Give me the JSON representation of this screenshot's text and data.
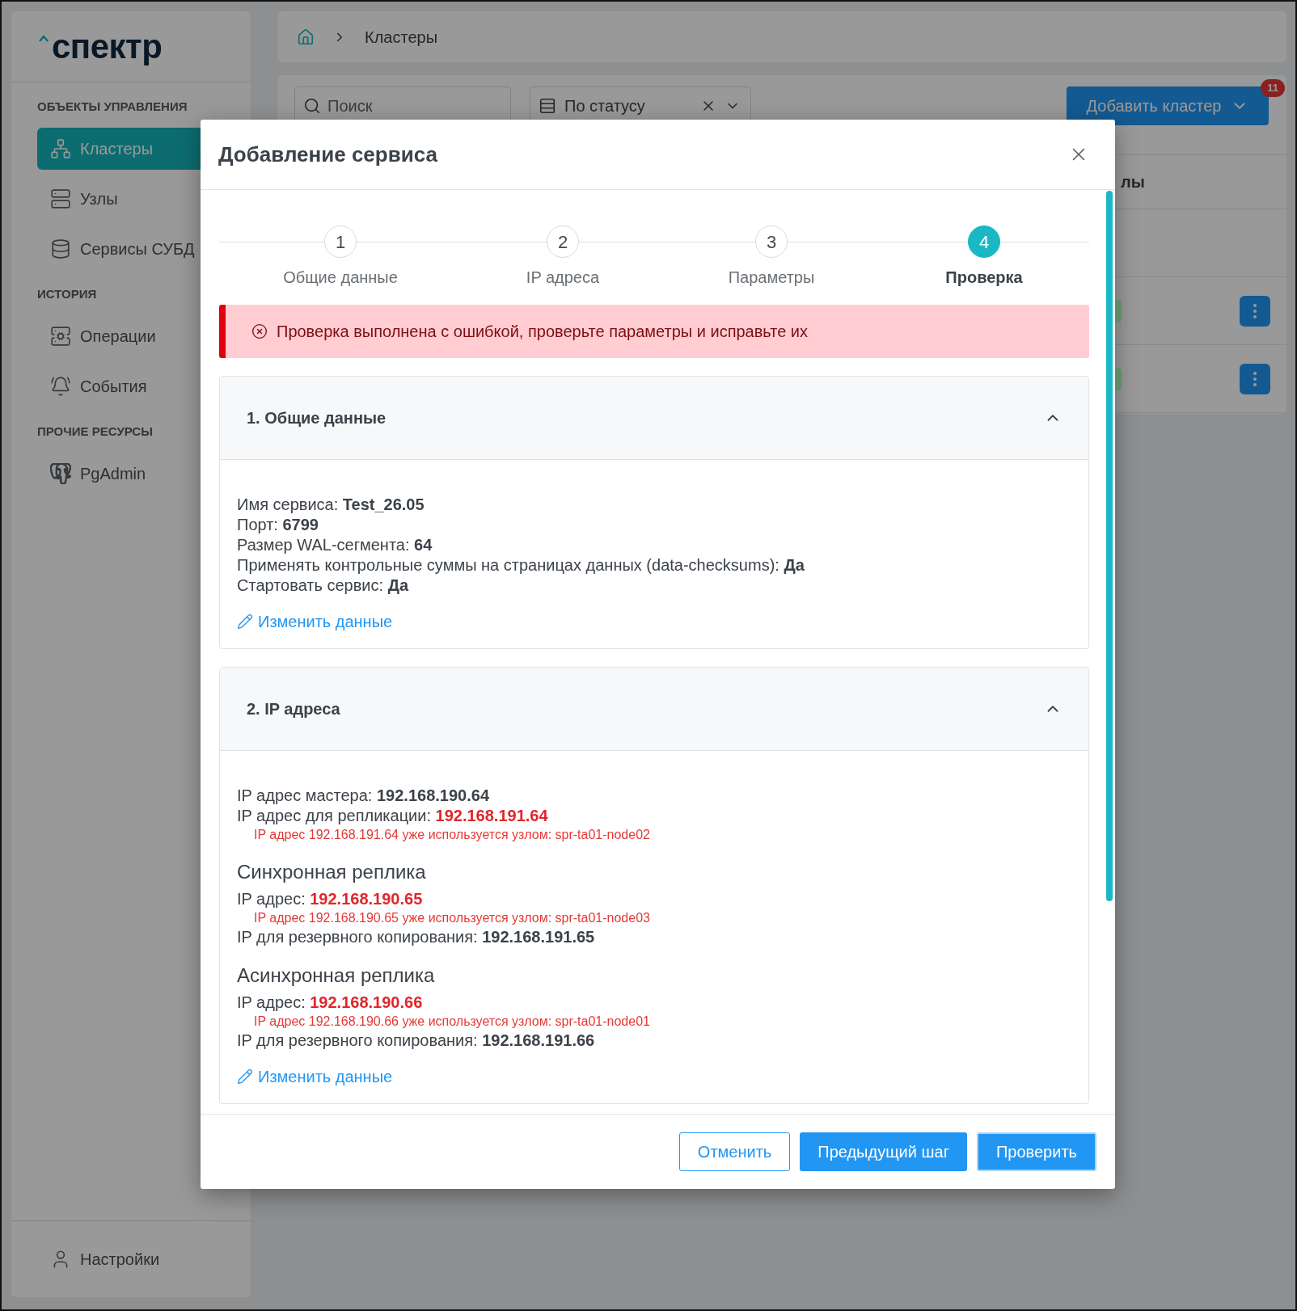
{
  "sidebar": {
    "logo": "спектр",
    "groups": [
      {
        "title": "ОБЪЕКТЫ УПРАВЛЕНИЯ",
        "items": [
          {
            "kind": "clusters",
            "label": "Кластеры",
            "selected": true
          },
          {
            "kind": "nodes",
            "label": "Узлы",
            "selected": false
          },
          {
            "kind": "services",
            "label": "Сервисы СУБД",
            "selected": false
          }
        ]
      },
      {
        "title": "ИСТОРИЯ",
        "items": [
          {
            "kind": "operations",
            "label": "Операции",
            "selected": false
          },
          {
            "kind": "events",
            "label": "События",
            "selected": false
          }
        ]
      },
      {
        "title": "ПРОЧИЕ РЕСУРСЫ",
        "items": [
          {
            "kind": "pgadmin",
            "label": "PgAdmin",
            "selected": false
          }
        ]
      }
    ],
    "footer_item": {
      "kind": "settings",
      "label": "Настройки"
    }
  },
  "breadcrumbs": [
    "Кластеры"
  ],
  "toolbar": {
    "search": {
      "placeholder": "Поиск"
    },
    "status_filter": {
      "placeholder": "По статусу"
    },
    "add_button": {
      "label": "Добавить кластер",
      "badge": "11"
    }
  },
  "table": {
    "columns": [
      "лы"
    ],
    "rows": [
      {
        "menu": false
      },
      {
        "menu": true,
        "color": "#5f8a65"
      },
      {
        "menu": true,
        "color": "#5f8a65"
      }
    ]
  },
  "dialog": {
    "title": "Добавление сервиса",
    "steps": [
      {
        "number": "1",
        "label": "Общие данные",
        "selected": false
      },
      {
        "number": "2",
        "label": "IP адреса",
        "selected": false
      },
      {
        "number": "3",
        "label": "Параметры",
        "selected": false
      },
      {
        "number": "4",
        "label": "Проверка",
        "selected": true
      }
    ],
    "alert": {
      "kind": "error",
      "text": "Проверка выполнена с ошибкой, проверьте параметры и исправьте их"
    },
    "sections": [
      {
        "title": "1. Общие данные",
        "expanded": true,
        "lines": [
          {
            "kind": "field",
            "label": "Имя сервиса:",
            "value": "Test_26.05",
            "invalid": false
          },
          {
            "kind": "field",
            "label": "Порт:",
            "value": "6799",
            "invalid": false
          },
          {
            "kind": "field",
            "label": "Размер WAL-сегмента:",
            "value": "64",
            "invalid": false
          },
          {
            "kind": "field",
            "label": "Применять контрольные суммы на страницах данных (data-checksums):",
            "value": "Да",
            "invalid": false
          },
          {
            "kind": "field",
            "label": "Стартовать сервис:",
            "value": "Да",
            "invalid": false
          }
        ],
        "edit_link": "Изменить данные"
      },
      {
        "title": "2. IP адреса",
        "expanded": true,
        "lines": [
          {
            "kind": "field",
            "label": "IP адрес мастера:",
            "value": "192.168.190.64",
            "invalid": false
          },
          {
            "kind": "field",
            "label": "IP адрес для репликации:",
            "value": "192.168.191.64",
            "invalid": true
          },
          {
            "kind": "error",
            "text": "IP адрес 192.168.191.64 уже используется узлом: spr-ta01-node02"
          },
          {
            "kind": "heading",
            "text": "Синхронная реплика"
          },
          {
            "kind": "field",
            "label": "IP адрес:",
            "value": "192.168.190.65",
            "invalid": true
          },
          {
            "kind": "error",
            "text": "IP адрес 192.168.190.65 уже используется узлом: spr-ta01-node03"
          },
          {
            "kind": "field",
            "label": "IP для резервного копирования:",
            "value": "192.168.191.65",
            "invalid": false
          },
          {
            "kind": "heading",
            "text": "Асинхронная реплика"
          },
          {
            "kind": "field",
            "label": "IP адрес:",
            "value": "192.168.190.66",
            "invalid": true
          },
          {
            "kind": "error",
            "text": "IP адрес 192.168.190.66 уже используется узлом: spr-ta01-node01"
          },
          {
            "kind": "field",
            "label": "IP для резервного копирования:",
            "value": "192.168.191.66",
            "invalid": false
          }
        ],
        "edit_link": "Изменить данные"
      }
    ],
    "buttons": [
      {
        "kind": "cancel",
        "label": "Отменить",
        "focused": false
      },
      {
        "kind": "back",
        "label": "Предыдущий шаг",
        "focused": false
      },
      {
        "kind": "submit",
        "label": "Проверить",
        "focused": true
      }
    ]
  }
}
